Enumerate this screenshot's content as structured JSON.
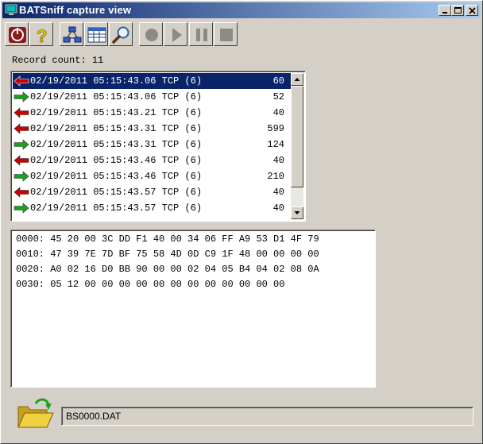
{
  "window": {
    "title": "BATSniff capture view"
  },
  "toolbar": {
    "buttons": [
      {
        "name": "power",
        "icon": "power-icon"
      },
      {
        "name": "help",
        "icon": "help-icon"
      },
      {
        "name": "network",
        "icon": "network-icon"
      },
      {
        "name": "table",
        "icon": "table-icon"
      },
      {
        "name": "find",
        "icon": "magnifier-icon"
      },
      {
        "name": "record",
        "icon": "record-icon"
      },
      {
        "name": "play",
        "icon": "play-icon"
      },
      {
        "name": "pause",
        "icon": "pause-icon"
      },
      {
        "name": "stop",
        "icon": "stop-icon"
      }
    ]
  },
  "records": {
    "count_label": "Record count: 11",
    "rows": [
      {
        "dir": "in",
        "datetime": "02/19/2011 05:15:43.06",
        "proto": "TCP (6)",
        "size": "60",
        "selected": true
      },
      {
        "dir": "out",
        "datetime": "02/19/2011 05:15:43.06",
        "proto": "TCP (6)",
        "size": "52"
      },
      {
        "dir": "in",
        "datetime": "02/19/2011 05:15:43.21",
        "proto": "TCP (6)",
        "size": "40"
      },
      {
        "dir": "in",
        "datetime": "02/19/2011 05:15:43.31",
        "proto": "TCP (6)",
        "size": "599"
      },
      {
        "dir": "out",
        "datetime": "02/19/2011 05:15:43.31",
        "proto": "TCP (6)",
        "size": "124"
      },
      {
        "dir": "in",
        "datetime": "02/19/2011 05:15:43.46",
        "proto": "TCP (6)",
        "size": "40"
      },
      {
        "dir": "out",
        "datetime": "02/19/2011 05:15:43.46",
        "proto": "TCP (6)",
        "size": "210"
      },
      {
        "dir": "in",
        "datetime": "02/19/2011 05:15:43.57",
        "proto": "TCP (6)",
        "size": "40"
      },
      {
        "dir": "out",
        "datetime": "02/19/2011 05:15:43.57",
        "proto": "TCP (6)",
        "size": "40"
      }
    ]
  },
  "hex": {
    "lines": [
      "0000: 45 20 00 3C DD F1 40 00 34 06 FF A9 53 D1 4F 79",
      "0010: 47 39 7E 7D BF 75 58 4D 0D C9 1F 48 00 00 00 00",
      "0020: A0 02 16 D0 BB 90 00 00 02 04 05 B4 04 02 08 0A",
      "0030: 05 12 00 00 00 00 00 00 00 00 00 00 00 00"
    ]
  },
  "file": {
    "name": "BS0000.DAT"
  },
  "colors": {
    "title_start": "#0a246a",
    "title_end": "#a6caf0",
    "selection": "#0a246a",
    "arrow_in": "#cc0000",
    "arrow_out": "#1aa31a"
  }
}
